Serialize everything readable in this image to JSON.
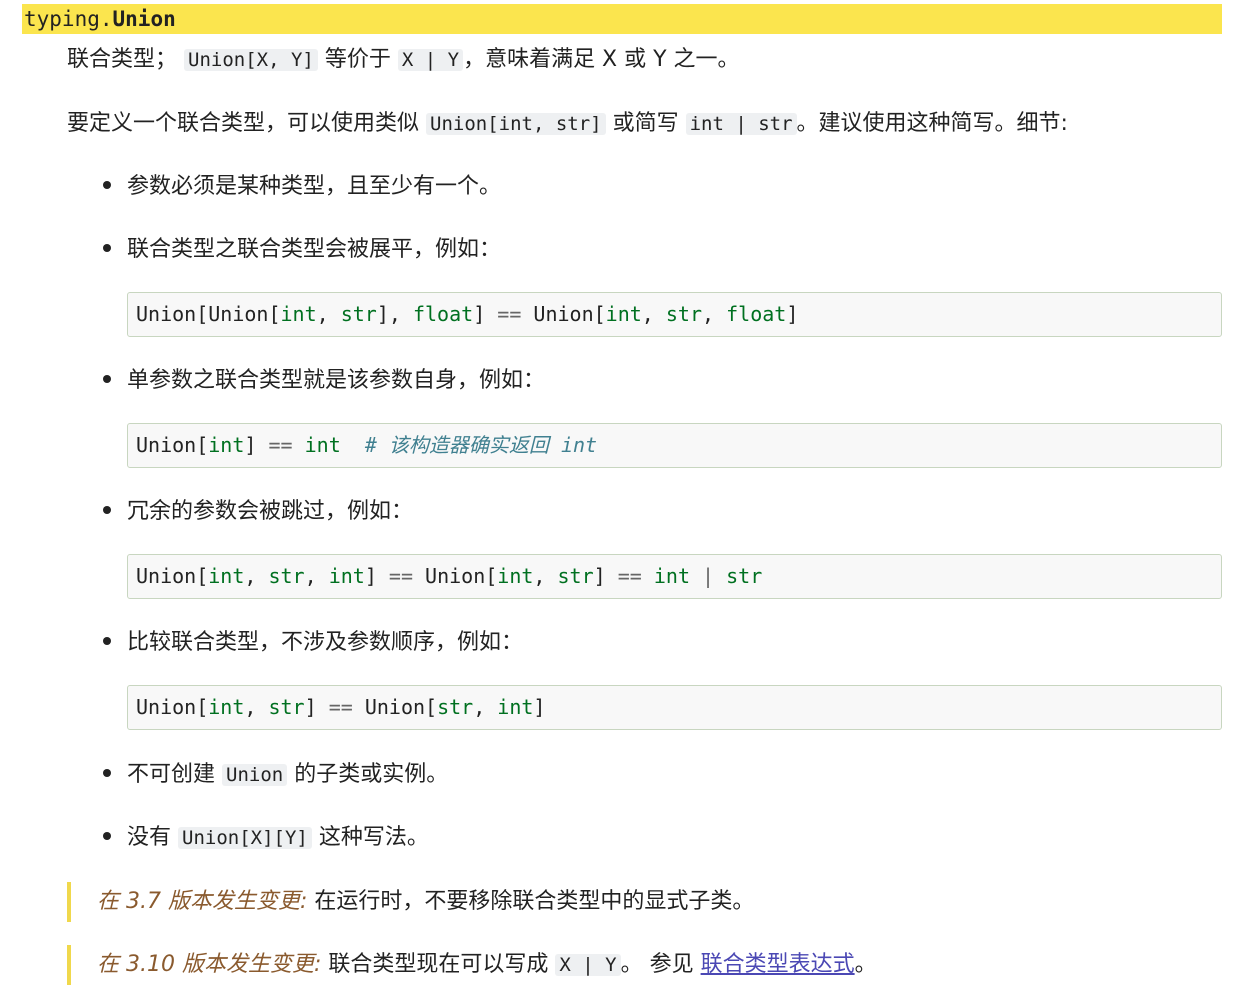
{
  "signature": {
    "module": "typing.",
    "name": "Union"
  },
  "intro": {
    "p1_a": "联合类型；",
    "p1_code1": "Union[X, Y]",
    "p1_b": " 等价于 ",
    "p1_code2": "X | Y",
    "p1_c": "，意味着满足 X 或 Y 之一。",
    "p2_a": "要定义一个联合类型，可以使用类似 ",
    "p2_code1": "Union[int, str]",
    "p2_b": " 或简写 ",
    "p2_code2": "int | str",
    "p2_c": "。建议使用这种简写。细节:"
  },
  "bullets": [
    {
      "text": "参数必须是某种类型，且至少有一个。"
    },
    {
      "text": "联合类型之联合类型会被展平，例如："
    },
    {
      "text": "单参数之联合类型就是该参数自身，例如："
    },
    {
      "text": "冗余的参数会被跳过，例如："
    },
    {
      "text": "比较联合类型，不涉及参数顺序，例如："
    },
    {
      "text_a": "不可创建 ",
      "code": "Union",
      "text_b": " 的子类或实例。"
    },
    {
      "text_a": "没有 ",
      "code": "Union[X][Y]",
      "text_b": " 这种写法。"
    }
  ],
  "code_blocks": [
    "Union[Union[int, str], float] == Union[int, str, float]",
    "Union[int] == int  # 该构造器确实返回 int",
    "Union[int, str, int] == Union[int, str] == int | str",
    "Union[int, str] == Union[str, int]"
  ],
  "version_changes": [
    {
      "label": "在 3.7 版本发生变更:",
      "text": " 在运行时，不要移除联合类型中的显式子类。"
    },
    {
      "label": "在 3.10 版本发生变更:",
      "text_a": " 联合类型现在可以写成 ",
      "code": "X | Y",
      "text_b": "。 参见 ",
      "link": "联合类型表达式",
      "text_c": "。"
    }
  ],
  "colors": {
    "signature_bg": "#fbe54e",
    "keyword": "#007020",
    "comment": "#408090",
    "version_label": "#8a5a2e",
    "link": "#4b48b4"
  }
}
